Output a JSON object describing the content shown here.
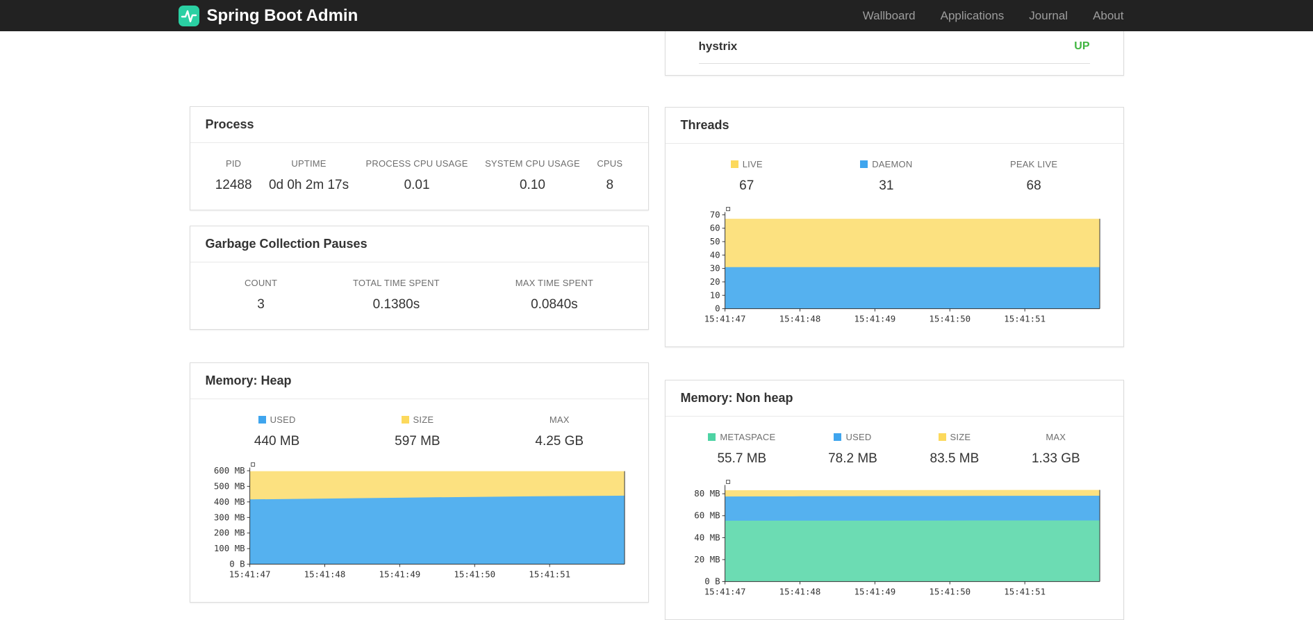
{
  "navbar": {
    "brand": "Spring Boot Admin",
    "logo_color": "#2bd0a3",
    "links": [
      {
        "label": "Wallboard"
      },
      {
        "label": "Applications"
      },
      {
        "label": "Journal"
      },
      {
        "label": "About"
      }
    ]
  },
  "application": {
    "name": "hystrix",
    "status": "UP",
    "status_color": "#3fb53f"
  },
  "cards": {
    "process": {
      "title": "Process",
      "metrics": [
        {
          "label": "PID",
          "value": "12488"
        },
        {
          "label": "UPTIME",
          "value": "0d 0h 2m 17s"
        },
        {
          "label": "PROCESS CPU USAGE",
          "value": "0.01"
        },
        {
          "label": "SYSTEM CPU USAGE",
          "value": "0.10"
        },
        {
          "label": "CPUS",
          "value": "8"
        }
      ]
    },
    "gc": {
      "title": "Garbage Collection Pauses",
      "metrics": [
        {
          "label": "COUNT",
          "value": "3"
        },
        {
          "label": "TOTAL TIME SPENT",
          "value": "0.1380s"
        },
        {
          "label": "MAX TIME SPENT",
          "value": "0.0840s"
        }
      ]
    },
    "threads": {
      "title": "Threads",
      "metrics": [
        {
          "label": "LIVE",
          "value": "67",
          "swatch": "#fcd95c"
        },
        {
          "label": "DAEMON",
          "value": "31",
          "swatch": "#3fa5ee"
        },
        {
          "label": "PEAK LIVE",
          "value": "68"
        }
      ]
    },
    "heap": {
      "title": "Memory: Heap",
      "metrics": [
        {
          "label": "USED",
          "value": "440 MB",
          "swatch": "#3fa5ee"
        },
        {
          "label": "SIZE",
          "value": "597 MB",
          "swatch": "#fcd95c"
        },
        {
          "label": "MAX",
          "value": "4.25 GB"
        }
      ]
    },
    "nonheap": {
      "title": "Memory: Non heap",
      "metrics": [
        {
          "label": "METASPACE",
          "value": "55.7 MB",
          "swatch": "#4ed3a4"
        },
        {
          "label": "USED",
          "value": "78.2 MB",
          "swatch": "#3fa5ee"
        },
        {
          "label": "SIZE",
          "value": "83.5 MB",
          "swatch": "#fcd95c"
        },
        {
          "label": "MAX",
          "value": "1.33 GB"
        }
      ]
    }
  },
  "chart_data": [
    {
      "id": "threads",
      "type": "area",
      "title": "Threads",
      "stacking": "overlay",
      "x_labels": [
        "15:41:47",
        "15:41:48",
        "15:41:49",
        "15:41:50",
        "15:41:51"
      ],
      "y_ticks": [
        0,
        10,
        20,
        30,
        40,
        50,
        60,
        70
      ],
      "y_tick_labels": [
        "0",
        "10",
        "20",
        "30",
        "40",
        "50",
        "60",
        "70"
      ],
      "ylim": [
        0,
        72
      ],
      "series": [
        {
          "name": "LIVE",
          "color": "#fce180",
          "values": [
            67,
            67,
            67,
            67,
            67,
            67
          ]
        },
        {
          "name": "DAEMON",
          "color": "#55b1ef",
          "values": [
            31,
            31,
            31,
            31,
            31,
            31
          ]
        }
      ]
    },
    {
      "id": "memory-heap",
      "type": "area",
      "title": "Memory: Heap",
      "stacking": "overlay",
      "x_labels": [
        "15:41:47",
        "15:41:48",
        "15:41:49",
        "15:41:50",
        "15:41:51"
      ],
      "y_ticks": [
        0,
        100,
        200,
        300,
        400,
        500,
        600
      ],
      "y_tick_labels": [
        "0 B",
        "100 MB",
        "200 MB",
        "300 MB",
        "400 MB",
        "500 MB",
        "600 MB"
      ],
      "ylim": [
        0,
        620
      ],
      "series": [
        {
          "name": "SIZE",
          "color": "#fce180",
          "values": [
            597,
            597,
            597,
            597,
            597,
            597
          ]
        },
        {
          "name": "USED",
          "color": "#55b1ef",
          "values": [
            416,
            421,
            427,
            432,
            437,
            440
          ]
        }
      ]
    },
    {
      "id": "memory-non-heap",
      "type": "area",
      "title": "Memory: Non heap",
      "stacking": "overlay",
      "x_labels": [
        "15:41:47",
        "15:41:48",
        "15:41:49",
        "15:41:50",
        "15:41:51"
      ],
      "y_ticks": [
        0,
        20,
        40,
        60,
        80
      ],
      "y_tick_labels": [
        "0 B",
        "20 MB",
        "40 MB",
        "60 MB",
        "80 MB"
      ],
      "ylim": [
        0,
        88
      ],
      "series": [
        {
          "name": "SIZE",
          "color": "#fce180",
          "values": [
            83.2,
            83.3,
            83.3,
            83.4,
            83.5,
            83.5
          ]
        },
        {
          "name": "USED",
          "color": "#55b1ef",
          "values": [
            77.5,
            77.7,
            77.9,
            78.0,
            78.1,
            78.2
          ]
        },
        {
          "name": "METASPACE",
          "color": "#6cdcb3",
          "values": [
            55.4,
            55.5,
            55.5,
            55.6,
            55.7,
            55.7
          ]
        }
      ]
    }
  ]
}
